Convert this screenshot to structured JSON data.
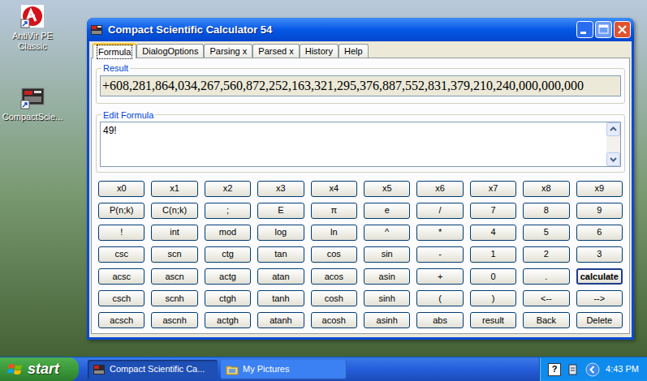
{
  "desktop_icons": [
    {
      "label": "AntiVir PE Classic"
    },
    {
      "label": "CompactScie..."
    }
  ],
  "window": {
    "title": "Compact Scientific Calculator 54"
  },
  "tabs": [
    {
      "label": "Formula",
      "selected": true
    },
    {
      "label": "DialogOptions",
      "selected": false
    },
    {
      "label": "Parsing x",
      "selected": false
    },
    {
      "label": "Parsed x",
      "selected": false
    },
    {
      "label": "History",
      "selected": false
    },
    {
      "label": "Help",
      "selected": false
    }
  ],
  "result": {
    "label": "Result",
    "value": "+608,281,864,034,267,560,872,252,163,321,295,376,887,552,831,379,210,240,000,000,000"
  },
  "formula": {
    "label": "Edit Formula",
    "value": "49!"
  },
  "keypad": [
    [
      {
        "label": "x0",
        "default": false
      },
      {
        "label": "x1",
        "default": false
      },
      {
        "label": "x2",
        "default": false
      },
      {
        "label": "x3",
        "default": false
      },
      {
        "label": "x4",
        "default": false
      },
      {
        "label": "x5",
        "default": false
      },
      {
        "label": "x6",
        "default": false
      },
      {
        "label": "x7",
        "default": false
      },
      {
        "label": "x8",
        "default": false
      },
      {
        "label": "x9",
        "default": false
      }
    ],
    [
      {
        "label": "P(n;k)",
        "default": false
      },
      {
        "label": "C(n;k)",
        "default": false
      },
      {
        "label": ";",
        "default": false
      },
      {
        "label": "E",
        "default": false
      },
      {
        "label": "π",
        "default": false
      },
      {
        "label": "e",
        "default": false
      },
      {
        "label": "/",
        "default": false
      },
      {
        "label": "7",
        "default": false
      },
      {
        "label": "8",
        "default": false
      },
      {
        "label": "9",
        "default": false
      }
    ],
    [
      {
        "label": "!",
        "default": false
      },
      {
        "label": "int",
        "default": false
      },
      {
        "label": "mod",
        "default": false
      },
      {
        "label": "log",
        "default": false
      },
      {
        "label": "ln",
        "default": false
      },
      {
        "label": "^",
        "default": false
      },
      {
        "label": "*",
        "default": false
      },
      {
        "label": "4",
        "default": false
      },
      {
        "label": "5",
        "default": false
      },
      {
        "label": "6",
        "default": false
      }
    ],
    [
      {
        "label": "csc",
        "default": false
      },
      {
        "label": "scn",
        "default": false
      },
      {
        "label": "ctg",
        "default": false
      },
      {
        "label": "tan",
        "default": false
      },
      {
        "label": "cos",
        "default": false
      },
      {
        "label": "sin",
        "default": false
      },
      {
        "label": "-",
        "default": false
      },
      {
        "label": "1",
        "default": false
      },
      {
        "label": "2",
        "default": false
      },
      {
        "label": "3",
        "default": false
      }
    ],
    [
      {
        "label": "acsc",
        "default": false
      },
      {
        "label": "ascn",
        "default": false
      },
      {
        "label": "actg",
        "default": false
      },
      {
        "label": "atan",
        "default": false
      },
      {
        "label": "acos",
        "default": false
      },
      {
        "label": "asin",
        "default": false
      },
      {
        "label": "+",
        "default": false
      },
      {
        "label": "0",
        "default": false
      },
      {
        "label": ".",
        "default": false
      },
      {
        "label": "calculate",
        "default": true
      }
    ],
    [
      {
        "label": "csch",
        "default": false
      },
      {
        "label": "scnh",
        "default": false
      },
      {
        "label": "ctgh",
        "default": false
      },
      {
        "label": "tanh",
        "default": false
      },
      {
        "label": "cosh",
        "default": false
      },
      {
        "label": "sinh",
        "default": false
      },
      {
        "label": "(",
        "default": false
      },
      {
        "label": ")",
        "default": false
      },
      {
        "label": "<--",
        "default": false
      },
      {
        "label": "-->",
        "default": false
      }
    ],
    [
      {
        "label": "acsch",
        "default": false
      },
      {
        "label": "ascnh",
        "default": false
      },
      {
        "label": "actgh",
        "default": false
      },
      {
        "label": "atanh",
        "default": false
      },
      {
        "label": "acosh",
        "default": false
      },
      {
        "label": "asinh",
        "default": false
      },
      {
        "label": "abs",
        "default": false
      },
      {
        "label": "result",
        "default": false
      },
      {
        "label": "Back",
        "default": false
      },
      {
        "label": "Delete",
        "default": false
      }
    ]
  ],
  "taskbar": {
    "start": "start",
    "tasks": [
      {
        "label": "Compact Scientific Ca...",
        "selected": true
      },
      {
        "label": "My Pictures",
        "selected": false
      }
    ],
    "tray": {
      "help": "?",
      "clock": "4:43 PM"
    }
  }
}
